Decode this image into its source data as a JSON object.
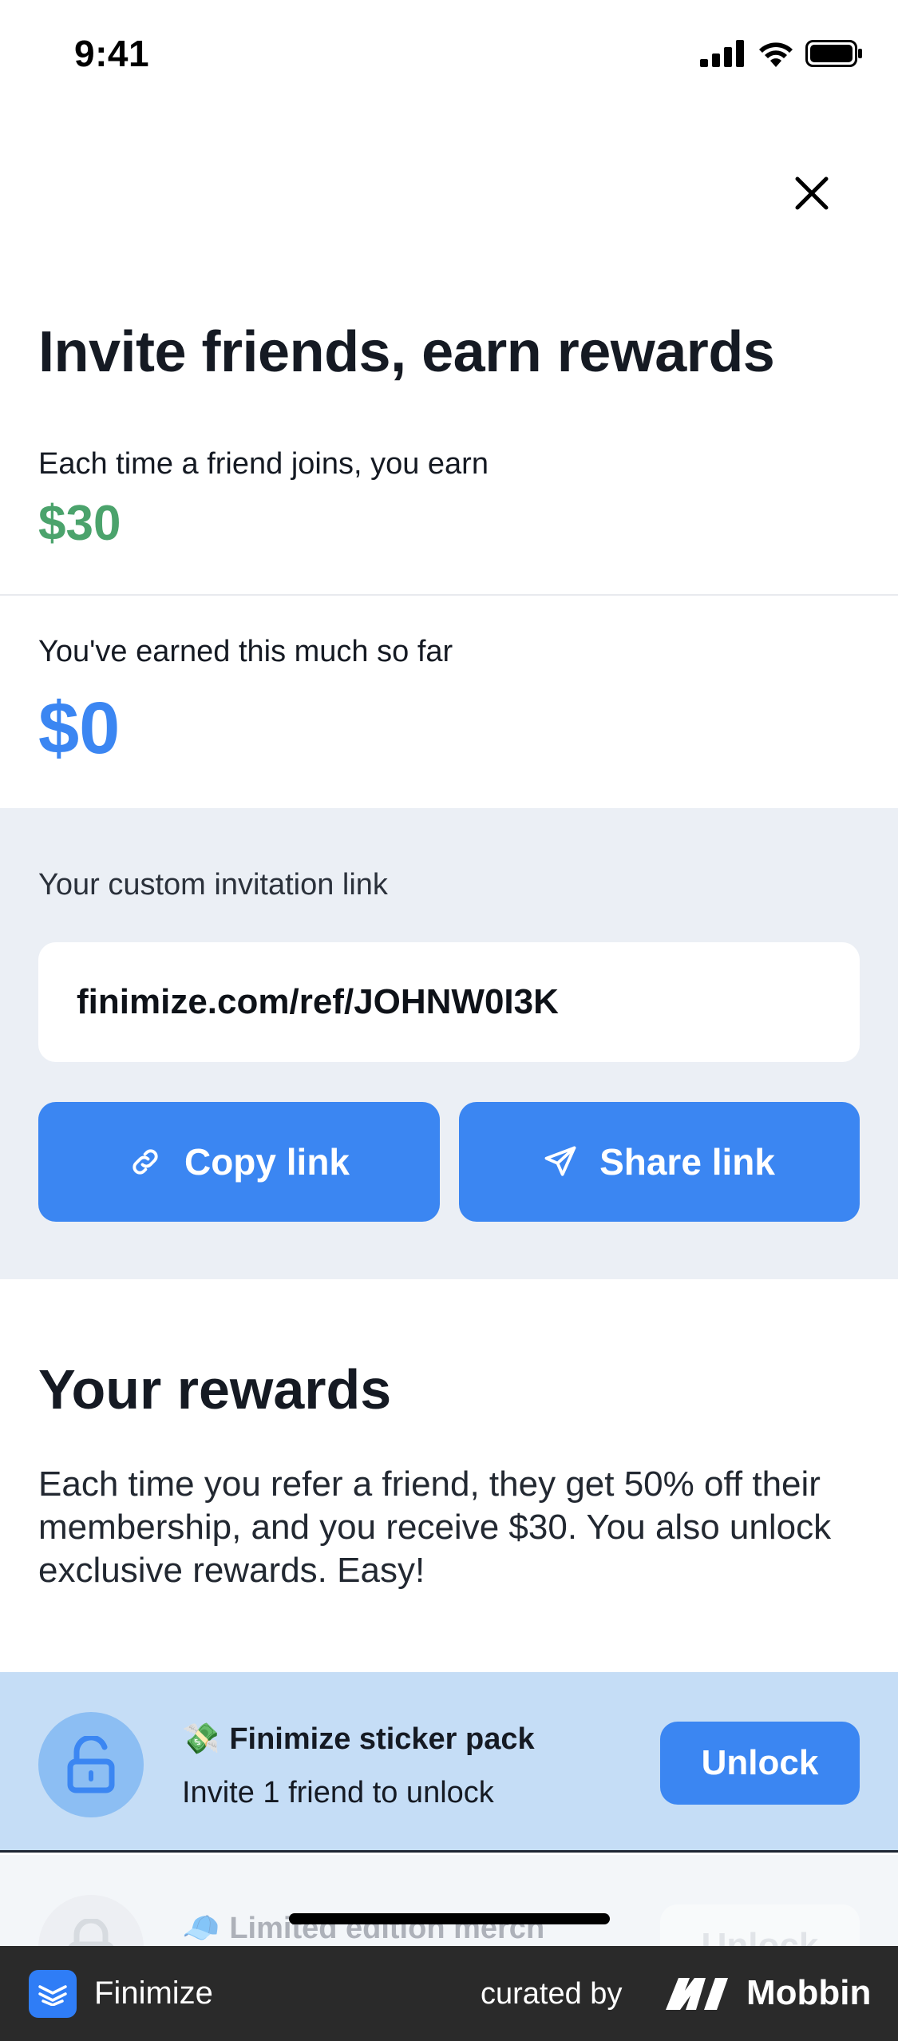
{
  "status_bar": {
    "time": "9:41"
  },
  "header": {
    "title": "Invite friends, earn rewards"
  },
  "earnings": {
    "per_friend_label": "Each time a friend joins, you earn",
    "per_friend_value": "$30",
    "so_far_label": "You've earned this much so far",
    "so_far_value": "$0"
  },
  "invitation": {
    "label": "Your custom invitation link",
    "link": "finimize.com/ref/JOHNW0I3K",
    "copy_label": "Copy link",
    "share_label": "Share link"
  },
  "rewards": {
    "title": "Your rewards",
    "description": "Each time you refer a friend, they get 50% off their membership, and you receive $30. You also unlock exclusive rewards. Easy!",
    "items": [
      {
        "emoji": "💸",
        "title": "Finimize sticker pack",
        "subtitle": "Invite 1 friend to unlock",
        "button": "Unlock"
      },
      {
        "emoji": "🧢",
        "title": "Limited edition merch",
        "button": "Unlock"
      }
    ]
  },
  "footer": {
    "app_name": "Finimize",
    "curated_by": "curated by",
    "brand": "Mobbin"
  },
  "colors": {
    "accent_blue": "#3b86f2",
    "green": "#4ba36c",
    "panel_bg": "#ebeff5",
    "reward_highlight_bg": "#c5ddf6"
  }
}
